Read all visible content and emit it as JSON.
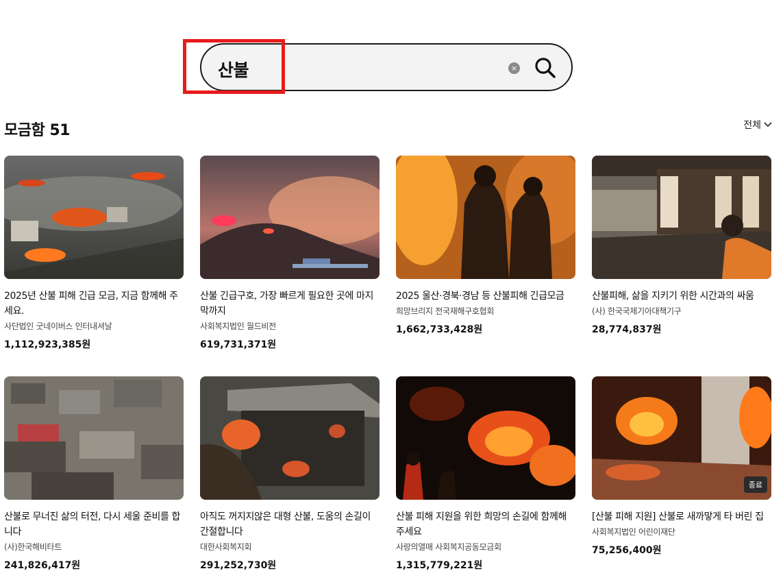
{
  "search": {
    "query": "산불",
    "clear_label": "×"
  },
  "results": {
    "heading": "모금함 51",
    "sort_label": "전체"
  },
  "cards": [
    {
      "title": "2025년 산불 피해 긴급 모금, 지금 함께해 주세요.",
      "org": "사단법인 굿네이버스 인터내셔날",
      "amount": "1,112,923,385원",
      "badge": ""
    },
    {
      "title": "산불 긴급구호, 가장 빠르게 필요한 곳에 마지막까지",
      "org": "사회복지법인 월드비전",
      "amount": "619,731,371원",
      "badge": ""
    },
    {
      "title": "2025 울산·경북·경남 등 산불피해 긴급모금",
      "org": "희망브리지 전국재해구호협회",
      "amount": "1,662,733,428원",
      "badge": ""
    },
    {
      "title": "산불피해, 삶을 지키기 위한 시간과의 싸움",
      "org": "(사) 한국국제기아대책기구",
      "amount": "28,774,837원",
      "badge": ""
    },
    {
      "title": "산불로 무너진 삶의 터전, 다시 세울 준비를 합니다",
      "org": "(사)한국해비타트",
      "amount": "241,826,417원",
      "badge": ""
    },
    {
      "title": "아직도 꺼지지않은 대형 산불, 도움의 손길이 간절합니다",
      "org": "대한사회복지회",
      "amount": "291,252,730원",
      "badge": ""
    },
    {
      "title": "산불 피해 지원을 위한 희망의 손길에 함께해 주세요",
      "org": "사랑의열매 사회복지공동모금회",
      "amount": "1,315,779,221원",
      "badge": ""
    },
    {
      "title": "[산불 피해 지원] 산불로 새까맣게 타 버린 집",
      "org": "사회복지법인 어린이재단",
      "amount": "75,256,400원",
      "badge": "종료"
    }
  ]
}
